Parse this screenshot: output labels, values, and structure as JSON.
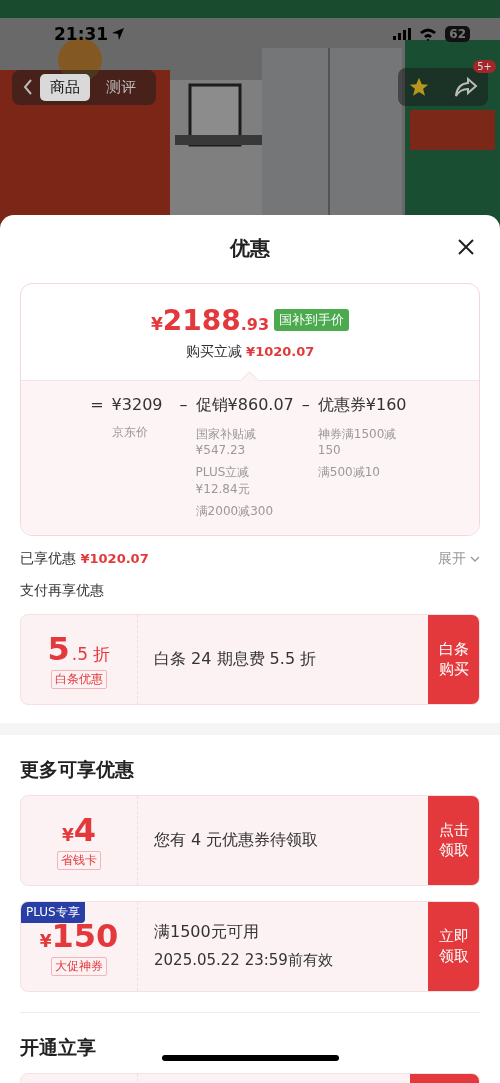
{
  "status_bar": {
    "time": "21:31",
    "battery": "62"
  },
  "nav": {
    "tabs": [
      {
        "label": "商品",
        "selected": true
      },
      {
        "label": "测评",
        "selected": false
      }
    ],
    "badge": "5+"
  },
  "sheet": {
    "title": "优惠"
  },
  "price_card": {
    "currency": "¥",
    "integer": "2188",
    "decimals": ".93",
    "tag": "国补到手价",
    "reduction_label": "购买立减",
    "reduction": "¥1020.07",
    "formula": [
      {
        "operator": "=",
        "term": "¥3209",
        "notes": [
          "京东价"
        ]
      },
      {
        "operator": "–",
        "term": "促销¥860.07",
        "notes": [
          "国家补贴减¥547.23",
          "PLUS立减¥12.84元",
          "满2000减300"
        ]
      },
      {
        "operator": "–",
        "term": "优惠券¥160",
        "notes": [
          "神券满1500减150",
          "满500减10"
        ]
      }
    ]
  },
  "applied": {
    "label": "已享优惠",
    "amount": "¥1020.07",
    "toggle": "展开"
  },
  "pay_section": {
    "title": "支付再享优惠",
    "coupons": [
      {
        "kind": "discount",
        "big": "5",
        "small": ".5 折",
        "tag": "白条优惠",
        "lines": [
          "白条 24 期息费 5.5 折"
        ],
        "action": "白条购买"
      }
    ]
  },
  "more_section": {
    "title": "更多可享优惠",
    "coupons": [
      {
        "kind": "cash",
        "currency": "¥",
        "big": "4",
        "tag": "省钱卡",
        "lines": [
          "您有 4 元优惠券待领取"
        ],
        "action": "点击领取"
      },
      {
        "kind": "cash",
        "badge": "PLUS专享",
        "currency": "¥",
        "big": "150",
        "tag": "大促神券",
        "lines": [
          "满1500元可用",
          "2025.05.22 23:59前有效"
        ],
        "action": "立即领取"
      }
    ]
  },
  "open_section": {
    "title": "开通立享"
  }
}
